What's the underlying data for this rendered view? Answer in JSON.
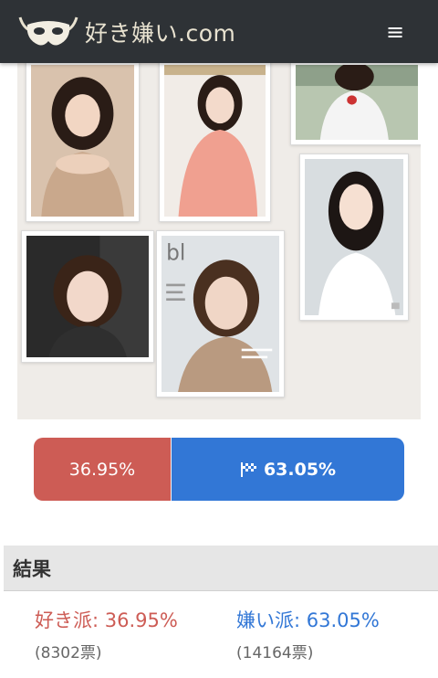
{
  "header": {
    "brand": "好き嫌い.com",
    "logo_icon": "mask-icon",
    "menu_icon": "hamburger-icon",
    "menu_glyph": "≡"
  },
  "gallery": {
    "photos": [
      {
        "name": "photo-1",
        "bg": "#d9c2ad",
        "hair": "#2a1c16",
        "cloth": "#c9a88c"
      },
      {
        "name": "photo-2",
        "bg": "#f1ece7",
        "hair": "#2a1c16",
        "cloth": "#f0a090"
      },
      {
        "name": "photo-3",
        "bg": "#b8c6b0",
        "hair": "#2a1c16",
        "cloth": "#f4f4f4"
      },
      {
        "name": "photo-4",
        "bg": "#2a2a2a",
        "hair": "#3a2418",
        "cloth": "#3a3a3a"
      },
      {
        "name": "photo-5",
        "bg": "#dfe3e6",
        "hair": "#4a3020",
        "cloth": "#b99a80"
      },
      {
        "name": "photo-6",
        "bg": "#d8dde0",
        "hair": "#1d1614",
        "cloth": "#ffffff"
      }
    ]
  },
  "vote": {
    "like_pct": "36.95%",
    "dislike_pct": "63.05%",
    "like_fraction": 0.3695,
    "flag_icon": "flag-checkered-icon",
    "like_color": "#cd5c55",
    "dislike_color": "#3277d6"
  },
  "result": {
    "title": "結果",
    "like_label": "好き派: 36.95%",
    "dislike_label": "嫌い派: 63.05%",
    "like_count": "(8302票)",
    "dislike_count": "(14164票)"
  }
}
